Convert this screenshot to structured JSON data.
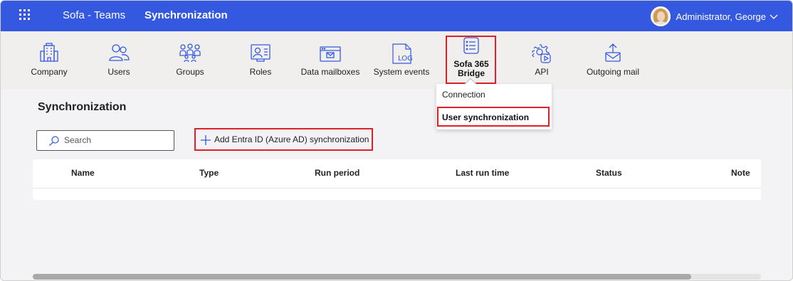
{
  "header": {
    "app_name": "Sofa - Teams",
    "page_name": "Synchronization",
    "user_name": "Administrator, George",
    "brand_color": "#3459e0"
  },
  "toolbar": {
    "items": [
      {
        "label": "Company",
        "icon": "building-icon"
      },
      {
        "label": "Users",
        "icon": "users-icon"
      },
      {
        "label": "Groups",
        "icon": "groups-icon"
      },
      {
        "label": "Roles",
        "icon": "roles-icon"
      },
      {
        "label": "Data mailboxes",
        "icon": "mailbox-icon"
      },
      {
        "label": "System events",
        "icon": "log-icon"
      },
      {
        "label_line1": "Sofa 365",
        "label_line2": "Bridge",
        "icon": "list-icon",
        "active": true
      },
      {
        "label": "API",
        "icon": "gear-play-icon"
      },
      {
        "label": "Outgoing mail",
        "icon": "outgoing-mail-icon"
      }
    ]
  },
  "dropdown": {
    "items": [
      {
        "label": "Connection"
      },
      {
        "label": "User synchronization",
        "selected": true
      }
    ]
  },
  "main": {
    "title": "Synchronization",
    "search_placeholder": "Search",
    "add_button": "Add Entra ID (Azure AD) synchronization",
    "columns": [
      "Name",
      "Type",
      "Run period",
      "Last run time",
      "Status",
      "Note"
    ]
  },
  "highlight_color": "#e01f26"
}
